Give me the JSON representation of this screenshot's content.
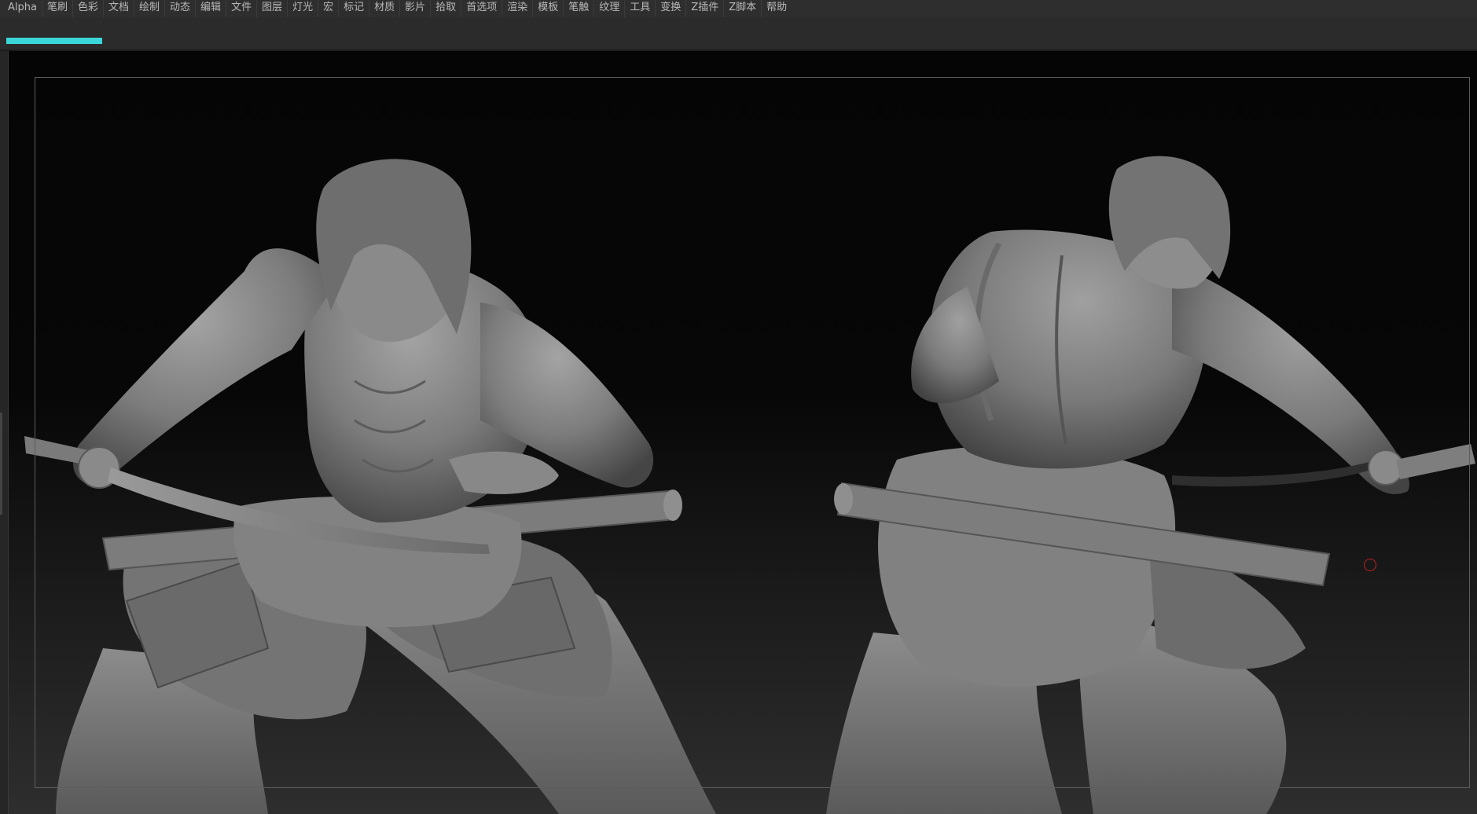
{
  "menubar": {
    "items": [
      {
        "id": "alpha",
        "label": "Alpha"
      },
      {
        "id": "brush",
        "label": "笔刷"
      },
      {
        "id": "color",
        "label": "色彩"
      },
      {
        "id": "document",
        "label": "文档"
      },
      {
        "id": "draw",
        "label": "绘制"
      },
      {
        "id": "movie-dyn",
        "label": "动态"
      },
      {
        "id": "edit",
        "label": "编辑"
      },
      {
        "id": "file",
        "label": "文件"
      },
      {
        "id": "layer",
        "label": "图层"
      },
      {
        "id": "light",
        "label": "灯光"
      },
      {
        "id": "macro",
        "label": "宏"
      },
      {
        "id": "marker",
        "label": "标记"
      },
      {
        "id": "material",
        "label": "材质"
      },
      {
        "id": "movie",
        "label": "影片"
      },
      {
        "id": "picker",
        "label": "拾取"
      },
      {
        "id": "preferences",
        "label": "首选项"
      },
      {
        "id": "render",
        "label": "渲染"
      },
      {
        "id": "stencil",
        "label": "模板"
      },
      {
        "id": "stroke",
        "label": "笔触"
      },
      {
        "id": "texture",
        "label": "纹理"
      },
      {
        "id": "tool",
        "label": "工具"
      },
      {
        "id": "transform",
        "label": "变换"
      },
      {
        "id": "zplugin",
        "label": "Z插件"
      },
      {
        "id": "zscript",
        "label": "Z脚本"
      },
      {
        "id": "help",
        "label": "帮助"
      }
    ]
  },
  "progress": {
    "fraction": 0.065,
    "color": "#3ad6d8"
  },
  "colors": {
    "menubar_bg": "#2e2e2e",
    "menu_text": "#b9b9b9",
    "canvas_top": "#050505",
    "canvas_bottom": "#2e2e2e",
    "clay": "#8a8a8a",
    "cursor": "#c02020"
  },
  "canvas": {
    "icon": "brush-cursor-icon"
  }
}
